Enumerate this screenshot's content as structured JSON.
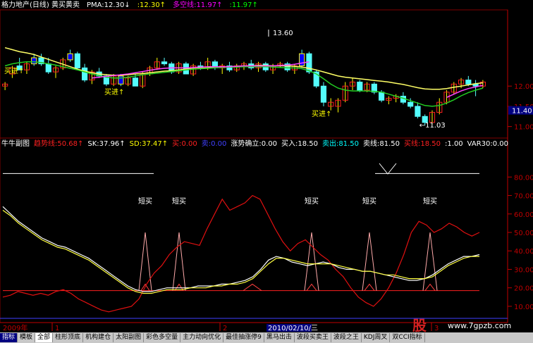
{
  "main_header": [
    {
      "text": "格力地产(日线) 黄买黄卖",
      "color": "#ffffff"
    },
    {
      "text": "PMA:12.30↓",
      "color": "#ffffff"
    },
    {
      "text": ":12.30↑",
      "color": "#ffff00"
    },
    {
      "text": "多空线:11.97↑",
      "color": "#ff00ff"
    },
    {
      "text": ":11.97↑",
      "color": "#00ff00"
    }
  ],
  "sub_header": [
    {
      "text": "牛牛副图",
      "color": "#ffffff"
    },
    {
      "text": "趋势线:50.68↑",
      "color": "#ff2020"
    },
    {
      "text": "SK:37.96↑",
      "color": "#ffffff"
    },
    {
      "text": "SD:37.47↑",
      "color": "#ffff00"
    },
    {
      "text": "买:0.00",
      "color": "#ff2020"
    },
    {
      "text": "卖:0.00",
      "color": "#4040ff"
    },
    {
      "text": "涨势确立:0.00",
      "color": "#ffffff"
    },
    {
      "text": "买入:18.50",
      "color": "#ffffff"
    },
    {
      "text": "卖出:81.50",
      "color": "#00ffff"
    },
    {
      "text": "卖线:81.50",
      "color": "#ffffff"
    },
    {
      "text": "买线:18.50",
      "color": "#ff2020"
    },
    {
      "text": ":1.00",
      "color": "#ffffff"
    },
    {
      "text": "VAR30:0.00",
      "color": "#ffffff"
    }
  ],
  "annotations": {
    "high": "13.60",
    "low": "←11.03",
    "buy_labels": [
      "买进↑",
      "买进↑",
      "买进↑"
    ],
    "short_buy_labels": [
      "短买",
      "短买",
      "短买",
      "短买",
      "短买"
    ]
  },
  "main_axis": {
    "ticks": [
      "12.00",
      "11.50",
      "11.00"
    ],
    "current_price": "11.40"
  },
  "sub_axis": {
    "ticks": [
      "80.00",
      "70.00",
      "60.00",
      "50.00",
      "40.00",
      "30.00",
      "20.00",
      "10.00"
    ]
  },
  "time_axis": {
    "year": "2009年",
    "marks": [
      "1",
      "2",
      "3"
    ],
    "cursor_date": "2010/02/10/三"
  },
  "tabs": [
    "指标",
    "模板",
    "全部",
    "柱形顶底",
    "机构建仓",
    "太阳副图",
    "彩色多空量",
    "主力动向优化",
    "最佳抽涨停9",
    "黑马出击",
    "波段买卖王",
    "波段之王",
    "KDJ周叉",
    "双CCI指标"
  ],
  "watermark": {
    "logo": "股",
    "url": "www.7gpzb.com"
  },
  "chart_data": {
    "type": "line",
    "main": {
      "candles": [
        {
          "o": 12.0,
          "h": 12.1,
          "l": 11.9,
          "c": 12.05,
          "color": "yellow"
        },
        {
          "o": 12.3,
          "h": 12.5,
          "l": 12.2,
          "c": 12.45,
          "color": "yellow"
        },
        {
          "o": 12.5,
          "h": 12.7,
          "l": 12.4,
          "c": 12.4,
          "color": "cyan"
        },
        {
          "o": 12.4,
          "h": 12.6,
          "l": 12.3,
          "c": 12.55,
          "color": "yellow"
        },
        {
          "o": 12.55,
          "h": 12.8,
          "l": 12.5,
          "c": 12.7,
          "color": "blue"
        },
        {
          "o": 12.7,
          "h": 12.8,
          "l": 12.5,
          "c": 12.55,
          "color": "cyan"
        },
        {
          "o": 12.55,
          "h": 12.7,
          "l": 12.3,
          "c": 12.35,
          "color": "cyan"
        },
        {
          "o": 12.35,
          "h": 12.5,
          "l": 12.2,
          "c": 12.45,
          "color": "yellow"
        },
        {
          "o": 12.45,
          "h": 12.7,
          "l": 12.4,
          "c": 12.65,
          "color": "yellow"
        },
        {
          "o": 12.65,
          "h": 12.9,
          "l": 12.6,
          "c": 12.8,
          "color": "blue"
        },
        {
          "o": 12.8,
          "h": 12.85,
          "l": 12.4,
          "c": 12.45,
          "color": "cyan"
        },
        {
          "o": 12.45,
          "h": 12.55,
          "l": 12.1,
          "c": 12.15,
          "color": "cyan"
        },
        {
          "o": 12.15,
          "h": 12.4,
          "l": 12.05,
          "c": 12.35,
          "color": "yellow"
        },
        {
          "o": 12.35,
          "h": 12.45,
          "l": 12.2,
          "c": 12.25,
          "color": "cyan"
        },
        {
          "o": 12.25,
          "h": 12.3,
          "l": 12.0,
          "c": 12.05,
          "color": "cyan"
        },
        {
          "o": 12.05,
          "h": 12.3,
          "l": 12.0,
          "c": 12.25,
          "color": "yellow"
        },
        {
          "o": 12.25,
          "h": 12.3,
          "l": 12.0,
          "c": 12.05,
          "color": "blue"
        },
        {
          "o": 12.05,
          "h": 12.25,
          "l": 12.0,
          "c": 12.2,
          "color": "yellow"
        },
        {
          "o": 12.2,
          "h": 12.3,
          "l": 12.0,
          "c": 12.0,
          "color": "cyan"
        },
        {
          "o": 12.0,
          "h": 12.35,
          "l": 11.95,
          "c": 12.3,
          "color": "yellow"
        },
        {
          "o": 12.3,
          "h": 12.5,
          "l": 12.25,
          "c": 12.45,
          "color": "yellow"
        },
        {
          "o": 12.45,
          "h": 12.7,
          "l": 12.4,
          "c": 12.6,
          "color": "yellow"
        },
        {
          "o": 12.6,
          "h": 12.7,
          "l": 12.5,
          "c": 12.55,
          "color": "cyan"
        },
        {
          "o": 12.55,
          "h": 12.6,
          "l": 12.3,
          "c": 12.35,
          "color": "cyan"
        },
        {
          "o": 12.35,
          "h": 12.6,
          "l": 12.3,
          "c": 12.55,
          "color": "yellow"
        },
        {
          "o": 12.55,
          "h": 12.6,
          "l": 12.3,
          "c": 12.3,
          "color": "cyan"
        },
        {
          "o": 12.3,
          "h": 12.55,
          "l": 12.25,
          "c": 12.5,
          "color": "yellow"
        },
        {
          "o": 12.5,
          "h": 12.6,
          "l": 12.4,
          "c": 12.45,
          "color": "cyan"
        },
        {
          "o": 12.45,
          "h": 12.7,
          "l": 12.4,
          "c": 12.6,
          "color": "yellow"
        },
        {
          "o": 12.6,
          "h": 12.65,
          "l": 12.4,
          "c": 12.45,
          "color": "cyan"
        },
        {
          "o": 12.45,
          "h": 12.55,
          "l": 12.3,
          "c": 12.5,
          "color": "yellow"
        },
        {
          "o": 12.5,
          "h": 12.6,
          "l": 12.35,
          "c": 12.4,
          "color": "cyan"
        },
        {
          "o": 12.4,
          "h": 12.55,
          "l": 12.35,
          "c": 12.5,
          "color": "yellow"
        },
        {
          "o": 12.5,
          "h": 12.6,
          "l": 12.4,
          "c": 12.55,
          "color": "yellow"
        },
        {
          "o": 12.55,
          "h": 12.65,
          "l": 12.4,
          "c": 12.45,
          "color": "cyan"
        },
        {
          "o": 12.45,
          "h": 12.6,
          "l": 12.35,
          "c": 12.55,
          "color": "yellow"
        },
        {
          "o": 12.55,
          "h": 12.6,
          "l": 12.35,
          "c": 12.4,
          "color": "cyan"
        },
        {
          "o": 12.4,
          "h": 12.55,
          "l": 12.3,
          "c": 12.5,
          "color": "yellow"
        },
        {
          "o": 12.5,
          "h": 12.6,
          "l": 12.45,
          "c": 12.55,
          "color": "yellow"
        },
        {
          "o": 12.55,
          "h": 12.6,
          "l": 12.35,
          "c": 12.4,
          "color": "cyan"
        },
        {
          "o": 12.4,
          "h": 12.55,
          "l": 12.3,
          "c": 12.5,
          "color": "yellow"
        },
        {
          "o": 12.5,
          "h": 12.9,
          "l": 12.45,
          "c": 12.8,
          "color": "blue"
        },
        {
          "o": 12.8,
          "h": 12.85,
          "l": 12.3,
          "c": 12.35,
          "color": "cyan"
        },
        {
          "o": 12.35,
          "h": 12.4,
          "l": 11.95,
          "c": 12.0,
          "color": "cyan"
        },
        {
          "o": 12.0,
          "h": 12.1,
          "l": 11.5,
          "c": 11.6,
          "color": "cyan"
        },
        {
          "o": 11.6,
          "h": 11.7,
          "l": 11.4,
          "c": 11.5,
          "color": "yellow"
        },
        {
          "o": 11.5,
          "h": 11.7,
          "l": 11.35,
          "c": 11.65,
          "color": "yellow"
        },
        {
          "o": 11.65,
          "h": 12.1,
          "l": 11.6,
          "c": 12.0,
          "color": "yellow"
        },
        {
          "o": 12.0,
          "h": 12.2,
          "l": 11.9,
          "c": 12.1,
          "color": "yellow"
        },
        {
          "o": 12.1,
          "h": 12.15,
          "l": 11.85,
          "c": 11.9,
          "color": "cyan"
        },
        {
          "o": 11.9,
          "h": 12.1,
          "l": 11.85,
          "c": 12.05,
          "color": "yellow"
        },
        {
          "o": 12.05,
          "h": 12.1,
          "l": 11.8,
          "c": 11.85,
          "color": "cyan"
        },
        {
          "o": 11.85,
          "h": 11.9,
          "l": 11.6,
          "c": 11.65,
          "color": "cyan"
        },
        {
          "o": 11.65,
          "h": 11.75,
          "l": 11.55,
          "c": 11.7,
          "color": "yellow"
        },
        {
          "o": 11.7,
          "h": 11.8,
          "l": 11.6,
          "c": 11.75,
          "color": "yellow"
        },
        {
          "o": 11.75,
          "h": 11.85,
          "l": 11.55,
          "c": 11.6,
          "color": "cyan"
        },
        {
          "o": 11.6,
          "h": 11.7,
          "l": 11.45,
          "c": 11.5,
          "color": "cyan"
        },
        {
          "o": 11.5,
          "h": 11.6,
          "l": 11.2,
          "c": 11.25,
          "color": "cyan"
        },
        {
          "o": 11.25,
          "h": 11.3,
          "l": 11.03,
          "c": 11.1,
          "color": "cyan"
        },
        {
          "o": 11.1,
          "h": 11.4,
          "l": 11.05,
          "c": 11.35,
          "color": "yellow"
        },
        {
          "o": 11.35,
          "h": 11.7,
          "l": 11.3,
          "c": 11.6,
          "color": "yellow"
        },
        {
          "o": 11.6,
          "h": 11.9,
          "l": 11.55,
          "c": 11.85,
          "color": "yellow"
        },
        {
          "o": 11.85,
          "h": 12.1,
          "l": 11.8,
          "c": 12.05,
          "color": "yellow"
        },
        {
          "o": 12.05,
          "h": 12.2,
          "l": 11.95,
          "c": 12.15,
          "color": "yellow"
        },
        {
          "o": 12.15,
          "h": 12.25,
          "l": 12.0,
          "c": 12.05,
          "color": "cyan"
        },
        {
          "o": 12.05,
          "h": 12.15,
          "l": 11.75,
          "c": 12.0,
          "color": "cyan"
        },
        {
          "o": 12.0,
          "h": 12.15,
          "l": 11.95,
          "c": 12.1,
          "color": "yellow"
        }
      ],
      "ma_yellow": [
        12.95,
        12.9,
        12.85,
        12.82,
        12.78,
        12.72,
        12.66,
        12.6,
        12.54,
        12.48,
        12.42,
        12.37,
        12.33,
        12.3,
        12.28,
        12.27,
        12.27,
        12.28,
        12.3,
        12.31,
        12.33,
        12.35,
        12.37,
        12.38,
        12.4,
        12.42,
        12.43,
        12.44,
        12.45,
        12.46,
        12.47,
        12.48,
        12.49,
        12.5,
        12.5,
        12.51,
        12.51,
        12.5,
        12.5,
        12.5,
        12.49,
        12.47,
        12.44,
        12.4,
        12.35,
        12.3,
        12.25,
        12.22,
        12.2,
        12.18,
        12.16,
        12.14,
        12.12,
        12.1,
        12.07,
        12.04,
        12.0,
        11.96,
        11.93,
        11.92,
        11.92,
        11.94,
        11.97,
        12.0,
        12.03,
        12.06,
        12.08
      ],
      "ma_green": [
        12.5,
        12.55,
        12.58,
        12.6,
        12.6,
        12.58,
        12.55,
        12.52,
        12.48,
        12.44,
        12.4,
        12.35,
        12.3,
        12.26,
        12.22,
        12.2,
        12.2,
        12.22,
        12.25,
        12.28,
        12.3,
        12.32,
        12.34,
        12.36,
        12.38,
        12.4,
        12.42,
        12.43,
        12.44,
        12.45,
        12.46,
        12.47,
        12.47,
        12.48,
        12.48,
        12.48,
        12.48,
        12.47,
        12.46,
        12.45,
        12.45,
        12.43,
        12.38,
        12.3,
        12.18,
        12.05,
        11.95,
        11.9,
        11.88,
        11.88,
        11.88,
        11.87,
        11.85,
        11.8,
        11.75,
        11.7,
        11.64,
        11.58,
        11.52,
        11.5,
        11.52,
        11.58,
        11.66,
        11.76,
        11.84,
        11.9,
        11.95
      ],
      "ma_magenta": [
        null,
        null,
        null,
        null,
        null,
        null,
        null,
        null,
        null,
        null,
        null,
        null,
        12.2,
        12.22,
        12.24,
        12.26,
        12.28,
        12.3,
        12.33,
        12.36,
        12.39,
        12.42,
        12.44,
        12.45,
        12.45,
        12.45,
        12.46,
        12.47,
        12.48,
        12.48,
        12.48,
        12.48,
        12.49,
        12.5,
        12.5,
        12.5,
        12.5,
        12.5,
        12.51,
        12.52,
        12.54,
        12.57,
        12.6,
        null,
        null,
        null,
        null,
        null,
        null,
        null,
        null,
        null,
        null,
        null,
        null,
        null,
        null,
        null,
        null,
        null,
        null,
        11.72,
        11.8,
        11.88,
        11.94,
        11.98,
        12.02
      ],
      "ylim": [
        10.75,
        13.85
      ],
      "axis_ticks": [
        12.0,
        11.5,
        11.0
      ],
      "current_price": 11.4
    },
    "sub": {
      "ylim": [
        5,
        95
      ],
      "axis_ticks": [
        80,
        70,
        60,
        50,
        40,
        30,
        20,
        10
      ],
      "trend_red": [
        15,
        16,
        18,
        17,
        16,
        17,
        16,
        18,
        19,
        17,
        14,
        12,
        10,
        8,
        7,
        8,
        9,
        10,
        14,
        22,
        28,
        32,
        38,
        42,
        45,
        44,
        43,
        52,
        60,
        68,
        62,
        64,
        66,
        70,
        68,
        60,
        52,
        45,
        40,
        44,
        46,
        42,
        38,
        35,
        30,
        26,
        20,
        15,
        12,
        10,
        14,
        20,
        28,
        38,
        50,
        56,
        54,
        50,
        52,
        55,
        53,
        50,
        48,
        50
      ],
      "sk_white": [
        64,
        60,
        56,
        53,
        50,
        47,
        45,
        43,
        42,
        40,
        38,
        36,
        33,
        30,
        27,
        24,
        21,
        19,
        18,
        18,
        19,
        20,
        20,
        20,
        20,
        21,
        21,
        21,
        22,
        22,
        23,
        24,
        26,
        30,
        35,
        37,
        36,
        34,
        33,
        32,
        33,
        34,
        33,
        31,
        30,
        30,
        29,
        29,
        28,
        27,
        26,
        25,
        24,
        24,
        25,
        27,
        30,
        33,
        35,
        37,
        37,
        38
      ],
      "sd_yellow": [
        62,
        59,
        55,
        52,
        49,
        46,
        44,
        42,
        41,
        39,
        37,
        35,
        32,
        29,
        26,
        23,
        20,
        18,
        17,
        17,
        18,
        19,
        19,
        19,
        20,
        20,
        20,
        21,
        21,
        22,
        22,
        23,
        25,
        29,
        33,
        36,
        36,
        35,
        34,
        33,
        33,
        33,
        33,
        32,
        31,
        30,
        29,
        29,
        28,
        27,
        27,
        26,
        25,
        25,
        25,
        26,
        29,
        32,
        34,
        36,
        37,
        37
      ],
      "buy_line": 18.5,
      "sell_line": 81.5
    }
  }
}
